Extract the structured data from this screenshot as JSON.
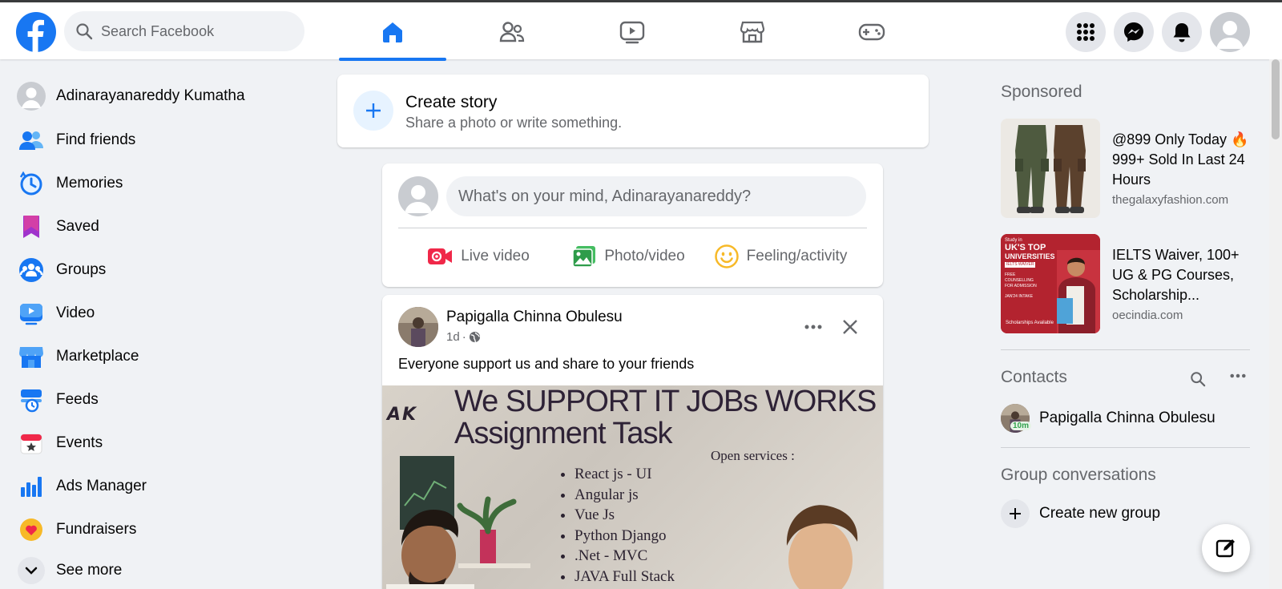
{
  "header": {
    "search_placeholder": "Search Facebook",
    "nav_tabs": [
      "home-tab",
      "friends-tab",
      "watch-tab",
      "marketplace-tab",
      "gaming-tab"
    ],
    "active_tab": "home-tab",
    "right_buttons": [
      "menu-icon",
      "messenger-icon",
      "notifications-icon",
      "account-icon"
    ]
  },
  "sidebar": {
    "items": [
      {
        "label": "Adinarayanareddy Kumatha",
        "icon": "profile-avatar"
      },
      {
        "label": "Find friends",
        "icon": "friends-icon"
      },
      {
        "label": "Memories",
        "icon": "memories-icon"
      },
      {
        "label": "Saved",
        "icon": "saved-icon"
      },
      {
        "label": "Groups",
        "icon": "groups-icon"
      },
      {
        "label": "Video",
        "icon": "video-icon"
      },
      {
        "label": "Marketplace",
        "icon": "marketplace-icon"
      },
      {
        "label": "Feeds",
        "icon": "feeds-icon"
      },
      {
        "label": "Events",
        "icon": "events-icon"
      },
      {
        "label": "Ads Manager",
        "icon": "ads-manager-icon"
      },
      {
        "label": "Fundraisers",
        "icon": "fundraisers-icon"
      },
      {
        "label": "See more",
        "icon": "chevron-down-icon"
      }
    ]
  },
  "story": {
    "title": "Create story",
    "subtitle": "Share a photo or write something."
  },
  "composer": {
    "placeholder": "What's on your mind, Adinarayanareddy?",
    "live_label": "Live video",
    "photo_label": "Photo/video",
    "feeling_label": "Feeling/activity"
  },
  "post": {
    "author": "Papigalla Chinna Obulesu",
    "time": "1d",
    "separator": "·",
    "caption": "Everyone support us and share to your friends",
    "image": {
      "brand": "AK",
      "headline": "We SUPPORT IT JOBs WORKS Assignment Task",
      "services_heading": "Open services :",
      "services": [
        "React js  - UI",
        "Angular js",
        "Vue Js",
        "Python Django",
        ".Net - MVC",
        "JAVA Full Stack"
      ]
    }
  },
  "right": {
    "sponsored_heading": "Sponsored",
    "ads": [
      {
        "title": "@899 Only Today 🔥 999+ Sold In Last 24 Hours",
        "domain": "thegalaxyfashion.com"
      },
      {
        "title": "IELTS Waiver, 100+ UG & PG Courses, Scholarship...",
        "domain": "oecindia.com"
      }
    ],
    "ad2_image_text": {
      "line1": "Study in",
      "line2": "UK'S TOP",
      "line3": "UNIVERSITIES",
      "badge": "IELTS WAIVER",
      "line4": "FREE COUNSELLING FOR ADMISSION",
      "line5": "JAN'24 INTAKE",
      "footer": "Scholarships Available"
    },
    "contacts_heading": "Contacts",
    "contacts": [
      {
        "name": "Papigalla Chinna Obulesu",
        "status": "10m"
      }
    ],
    "groups_heading": "Group conversations",
    "create_group_label": "Create new group"
  },
  "colors": {
    "brand": "#1877f2",
    "page_bg": "#f0f2f5",
    "secondary_text": "#65676b",
    "online_green": "#31a24c"
  }
}
